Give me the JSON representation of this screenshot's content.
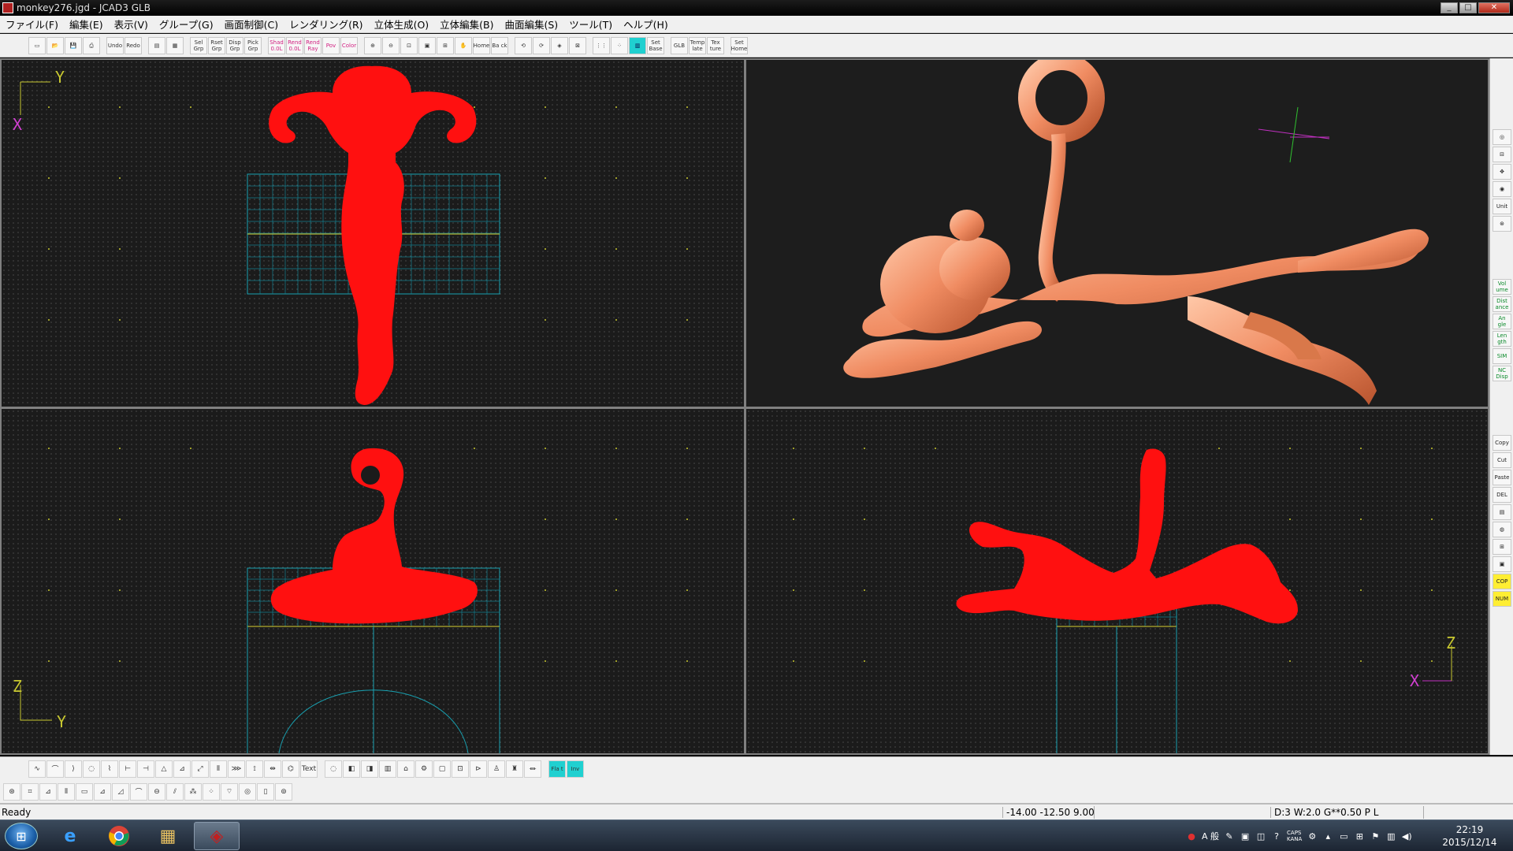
{
  "window": {
    "title": "monkey276.jgd - JCAD3 GLB",
    "min": "_",
    "max": "□",
    "close": "✕"
  },
  "menu": [
    "ファイル(F)",
    "編集(E)",
    "表示(V)",
    "グループ(G)",
    "画面制御(C)",
    "レンダリング(R)",
    "立体生成(O)",
    "立体編集(B)",
    "曲面編集(S)",
    "ツール(T)",
    "ヘルプ(H)"
  ],
  "toolbar": {
    "groups": [
      [
        "",
        "",
        "",
        ""
      ],
      [
        "Undo",
        "Redo"
      ],
      [
        "",
        ""
      ],
      [
        "Sel Grp",
        "Rset Grp",
        "Disp Grp",
        "Pick Grp"
      ],
      [
        "Shad 0.0L",
        "Rend 0.0L",
        "Rend Ray",
        "Pov",
        "Color"
      ],
      [
        "",
        "",
        "",
        "",
        "",
        "",
        "Home",
        "Ba ck"
      ],
      [
        "",
        "",
        "",
        ""
      ],
      [
        "",
        "",
        "",
        "Set Base"
      ],
      [
        "GLB",
        "Temp late",
        "Tex ture"
      ],
      [
        "Set Home"
      ]
    ]
  },
  "viewports": {
    "top_left_axis_y": "Y",
    "top_left_axis_x": "X",
    "bottom_left_axis_z": "Z",
    "bottom_left_axis_y": "Y",
    "bottom_right_axis_z": "Z",
    "bottom_right_axis_x": "X"
  },
  "side_panel": [
    "",
    "",
    "",
    "",
    "Unit",
    "",
    "Vol ume",
    "Dist ance",
    "An gle",
    "Len gth",
    "SIM",
    "NC Disp",
    "Copy",
    "Cut",
    "Paste",
    "DEL",
    "",
    "",
    "",
    "",
    "COP",
    "NUM"
  ],
  "bottom_toolbar_1_labels": [
    "",
    "",
    "",
    "",
    "",
    "",
    "",
    "",
    "",
    "",
    "",
    "",
    "",
    "",
    "",
    "",
    "Text",
    "",
    "",
    "",
    "",
    "",
    "",
    "",
    "",
    "",
    "",
    "",
    "",
    "",
    "Fla t",
    "Inv"
  ],
  "status": {
    "ready": "Ready",
    "coords": "-14.00 -12.50 9.00",
    "mode": "D:3 W:2.0  G**0.50 P  L"
  },
  "taskbar": {
    "time": "22:19",
    "date": "2015/12/14",
    "ime_mode": "A 般",
    "caps": "CAPS",
    "kana": "KANA"
  }
}
